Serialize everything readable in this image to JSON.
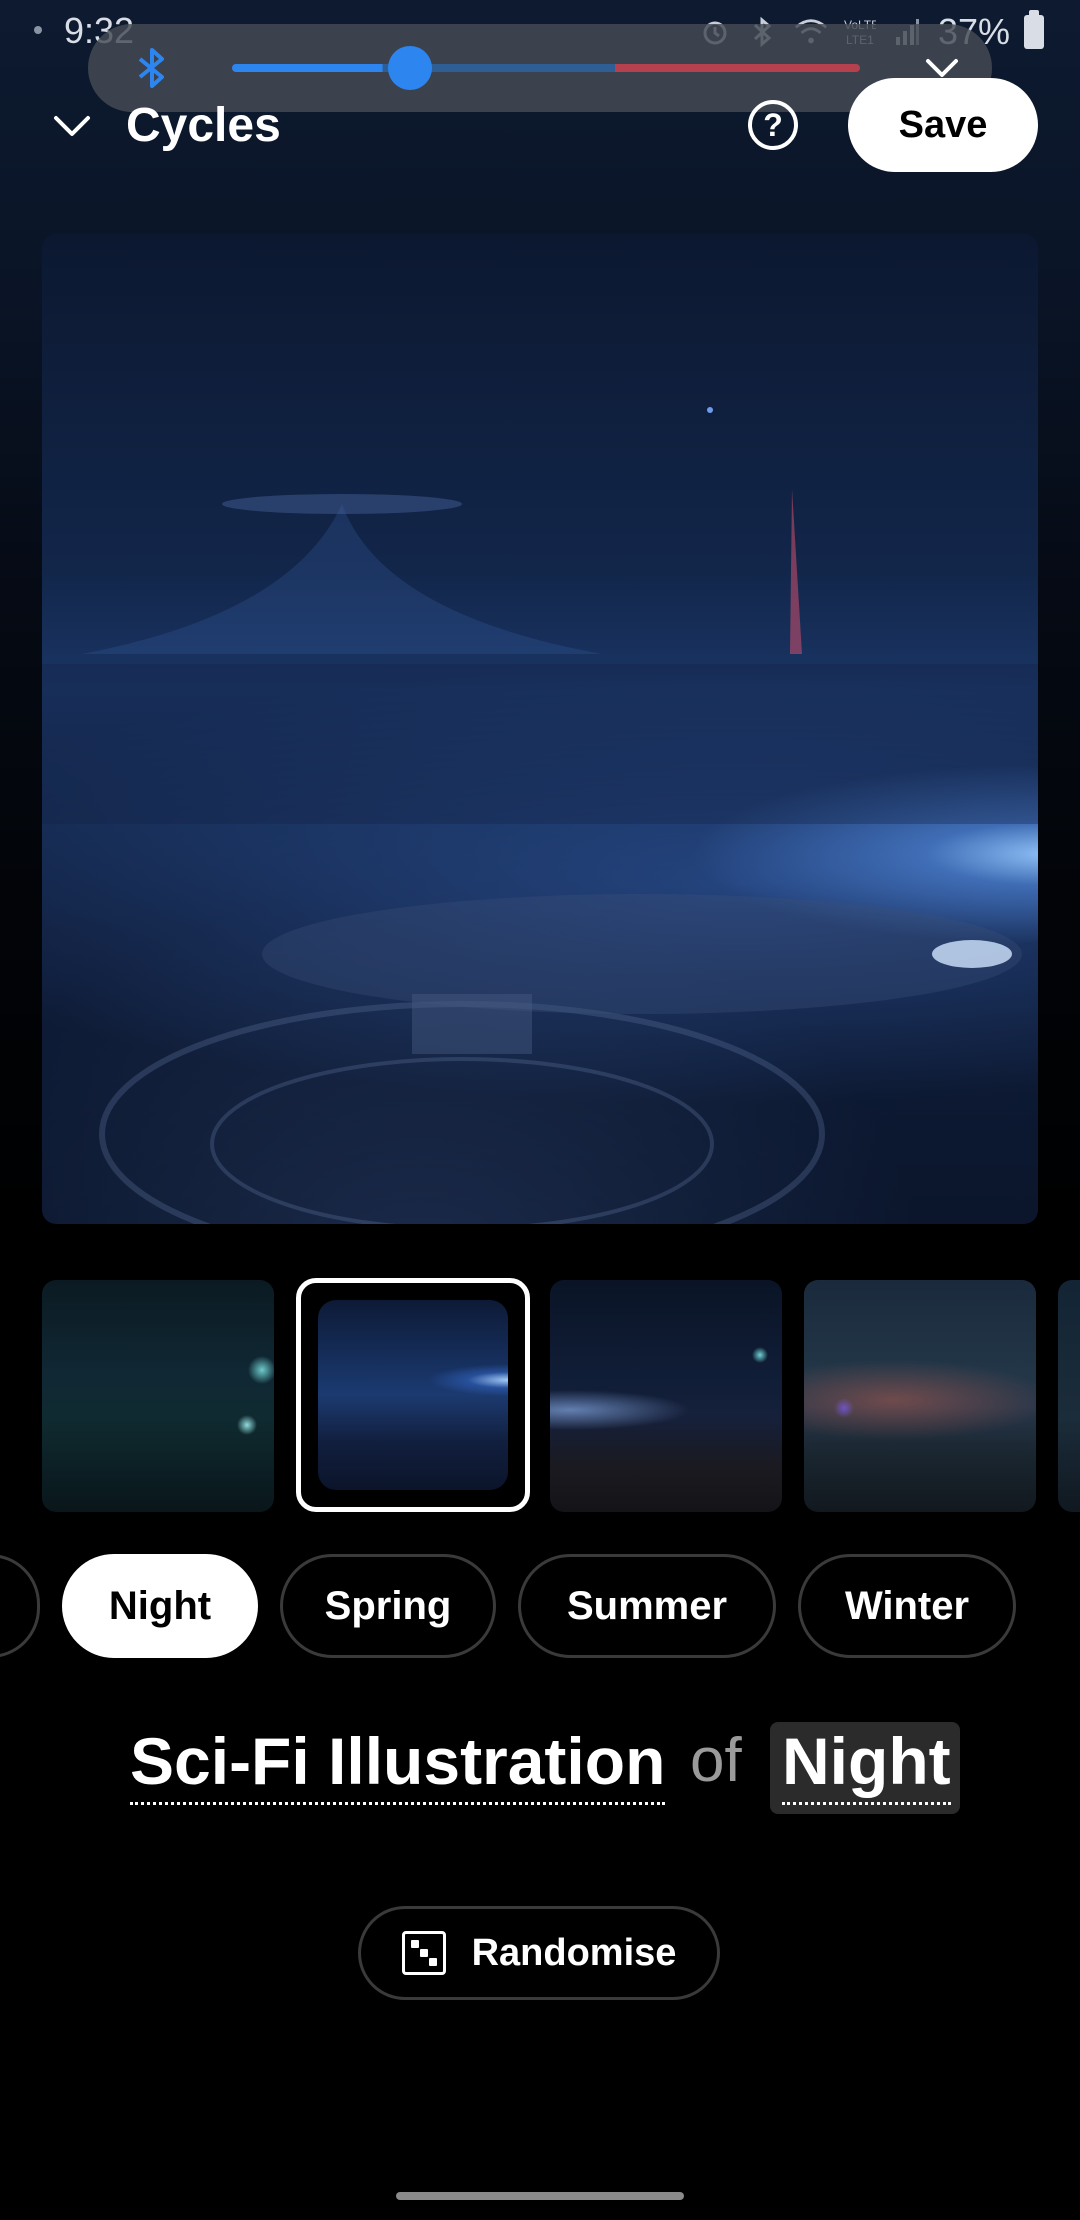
{
  "status_bar": {
    "time": "9:32",
    "battery": "37%",
    "icons": [
      "alarm-icon",
      "bluetooth-icon",
      "wifi-icon",
      "volte-lte-icon",
      "signal-icon",
      "battery-icon"
    ]
  },
  "volume_panel": {
    "device_icon": "bluetooth-icon",
    "level": 0.24,
    "colors": {
      "active": "#2d86f0",
      "inactive": "#2f5e94",
      "warning": "#b4414d"
    }
  },
  "header": {
    "title": "Cycles",
    "help_label": "?",
    "save_label": "Save"
  },
  "preview": {
    "image": "sci-fi-night-cityscape"
  },
  "thumbnails": [
    {
      "image": "teal-city-night",
      "selected": false
    },
    {
      "image": "blue-horizon-night",
      "selected": true
    },
    {
      "image": "dusk-spires",
      "selected": false
    },
    {
      "image": "red-dusk-towers",
      "selected": false
    },
    {
      "image": "partial",
      "selected": false
    }
  ],
  "chips": [
    {
      "label": "",
      "selected": false
    },
    {
      "label": "Night",
      "selected": true
    },
    {
      "label": "Spring",
      "selected": false
    },
    {
      "label": "Summer",
      "selected": false
    },
    {
      "label": "Winter",
      "selected": false
    }
  ],
  "prompt": {
    "style": "Sci-Fi Illustration",
    "connector": "of",
    "subject": "Night"
  },
  "randomise": {
    "label": "Randomise",
    "icon": "dice-icon"
  }
}
